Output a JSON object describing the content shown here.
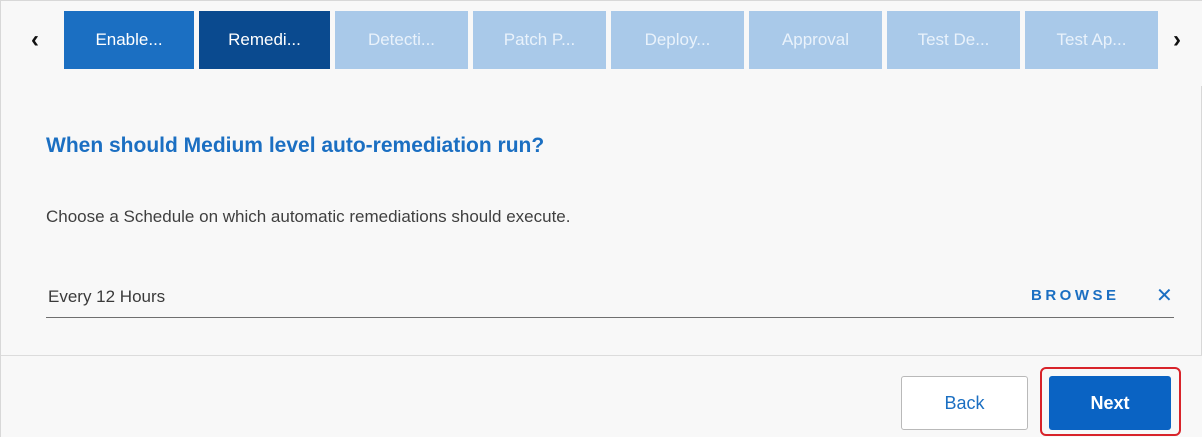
{
  "tabs": {
    "prev_glyph": "‹",
    "next_glyph": "›",
    "items": [
      {
        "label": "Enable...",
        "state": "done"
      },
      {
        "label": "Remedi...",
        "state": "active"
      },
      {
        "label": "Detecti...",
        "state": "pending"
      },
      {
        "label": "Patch P...",
        "state": "pending"
      },
      {
        "label": "Deploy...",
        "state": "pending"
      },
      {
        "label": "Approval",
        "state": "pending"
      },
      {
        "label": "Test De...",
        "state": "pending"
      },
      {
        "label": "Test Ap...",
        "state": "pending"
      }
    ]
  },
  "main": {
    "heading": "When should Medium level auto-remediation run?",
    "description": "Choose a Schedule on which automatic remediations should execute.",
    "schedule": {
      "value": "Every 12 Hours",
      "browse_label": "BROWSE",
      "clear_glyph": "✕"
    }
  },
  "footer": {
    "back_label": "Back",
    "next_label": "Next"
  },
  "colors": {
    "accent": "#1b6fc2",
    "active_tab": "#0a4a8f",
    "pending_tab": "#a9c9e9",
    "primary_button": "#0a63c3",
    "highlight": "#d8232a"
  }
}
